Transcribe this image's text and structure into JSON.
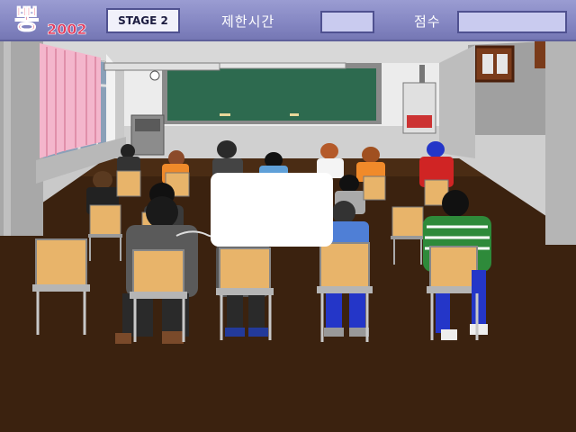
{
  "hud": {
    "logo_text": "뽕2002",
    "stage_label": "STAGE 2",
    "time_label": "제한시간",
    "time_value": "",
    "score_label": "점수",
    "score_value": ""
  },
  "speech_bubble": {
    "text": ""
  },
  "colors": {
    "hud_bg": "#8486c2",
    "field_bg": "#c9cbef",
    "floor": "#3b220f",
    "wall": "#dcdcdc",
    "chalkboard": "#2d6a4f",
    "curtain": "#f4b6cc"
  }
}
